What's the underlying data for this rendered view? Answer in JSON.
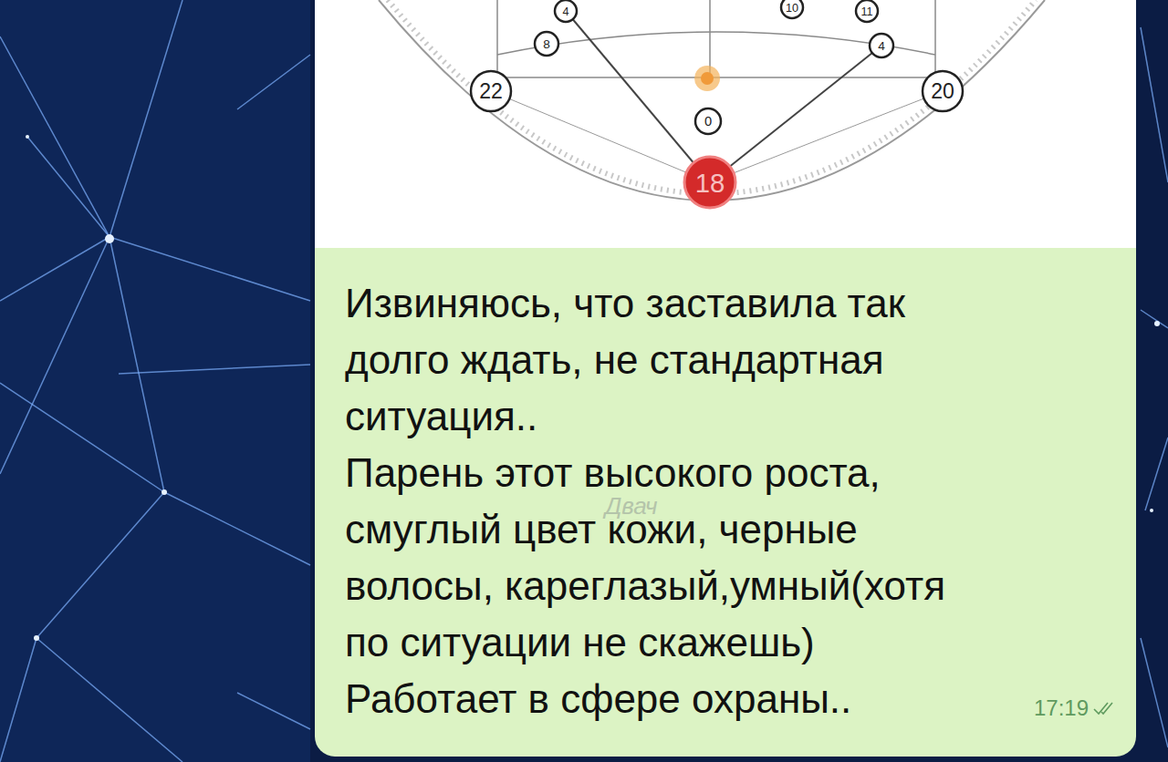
{
  "chat": {
    "message": {
      "image": {
        "diagram": {
          "nodes": [
            {
              "label": "22",
              "highlighted": false
            },
            {
              "label": "20",
              "highlighted": false
            },
            {
              "label": "8",
              "highlighted": false
            },
            {
              "label": "4",
              "highlighted": false
            },
            {
              "label": "10",
              "highlighted": false
            },
            {
              "label": "11",
              "highlighted": false
            },
            {
              "label": "4",
              "highlighted": false
            },
            {
              "label": "0",
              "highlighted": false
            },
            {
              "label": "18",
              "highlighted": true
            }
          ]
        }
      },
      "lines": [
        "Извиняюсь, что заставила так",
        "долго ждать, не стандартная",
        "ситуация..",
        "Парень этот высокого роста,",
        "смуглый цвет кожи, черные",
        "волосы, кареглазый,умный(хотя",
        "по ситуации не скажешь)",
        "Работает в сфере охраны.."
      ],
      "time": "17:19",
      "read": true
    },
    "watermark": "Двач"
  }
}
